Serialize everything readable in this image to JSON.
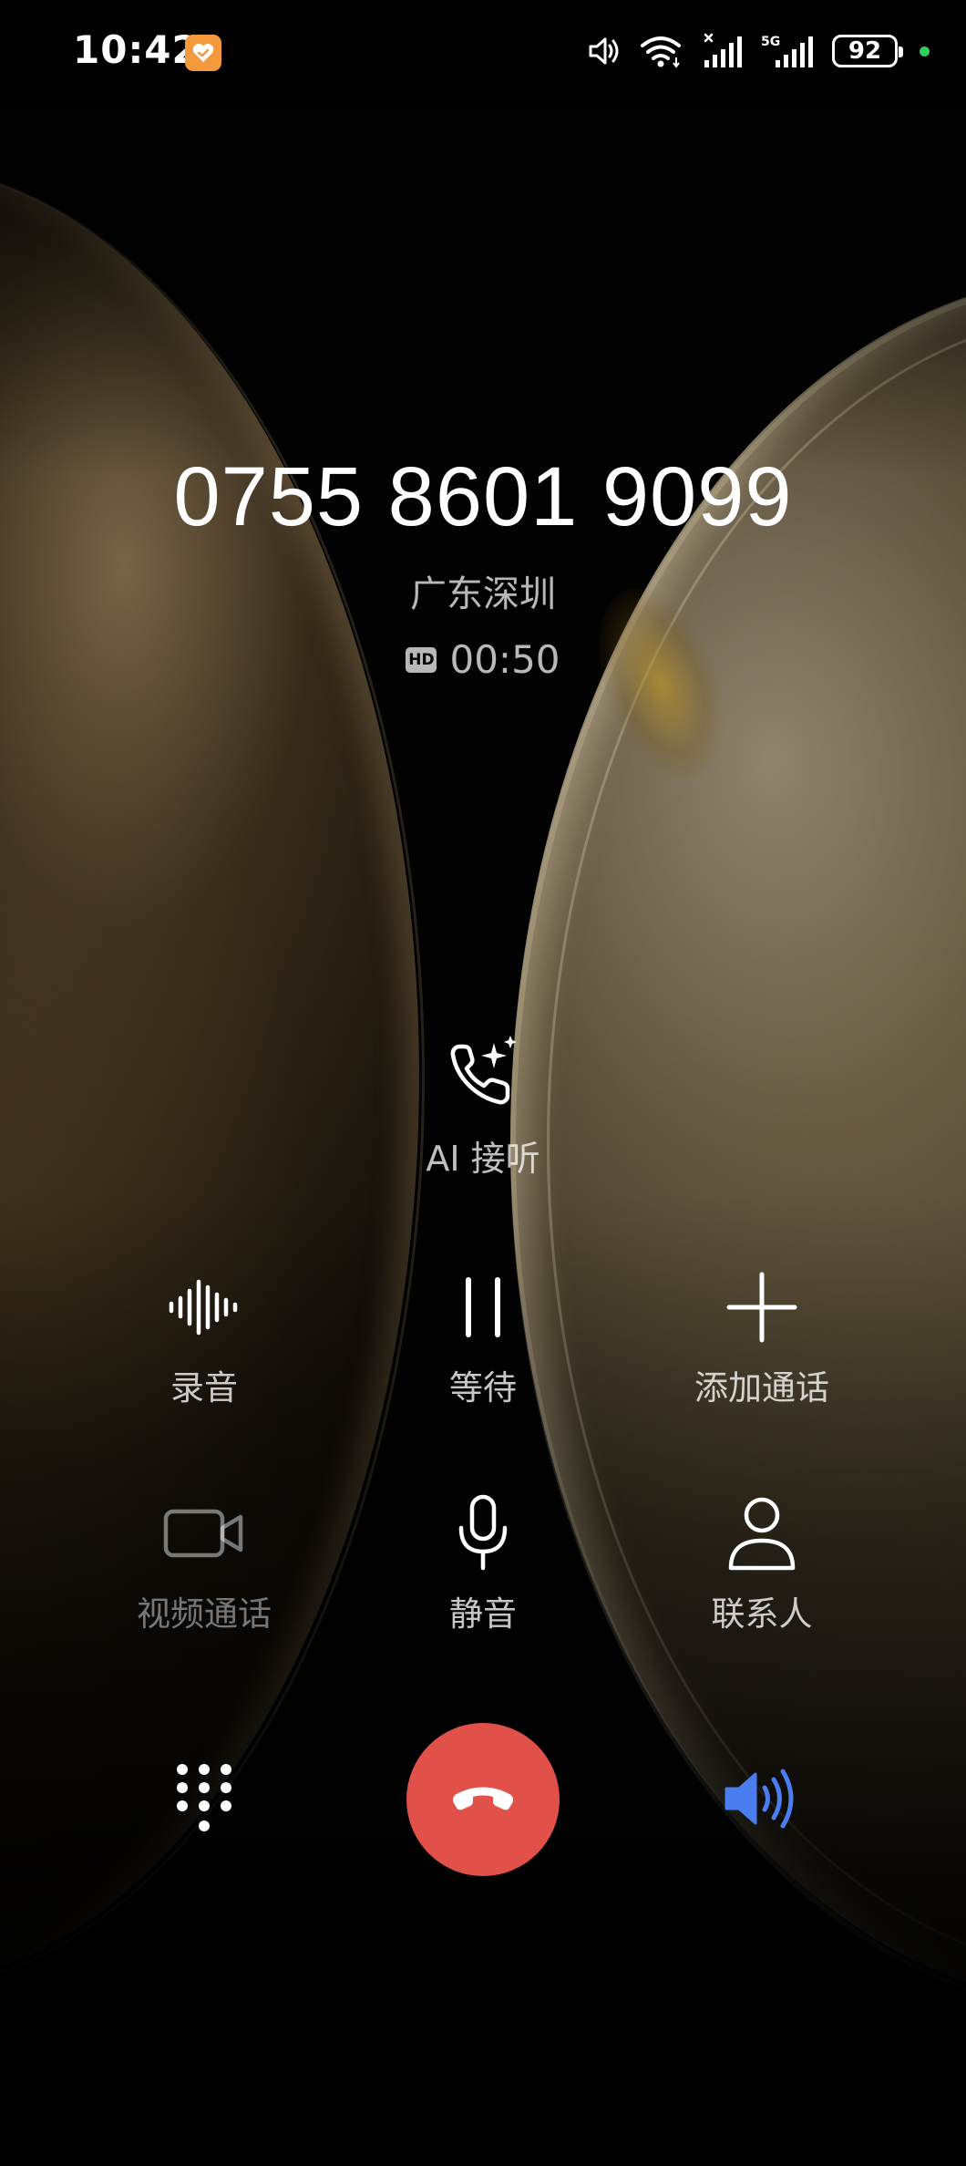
{
  "status_bar": {
    "time": "10:42",
    "battery_level": "92",
    "network_type": "5G",
    "icons": [
      "volume-icon",
      "wifi-icon",
      "signal-icon",
      "signal-5g-icon",
      "battery-icon",
      "charging-dot-icon"
    ]
  },
  "call": {
    "number": "0755 8601 9099",
    "location": "广东深圳",
    "quality_badge": "HD",
    "duration": "00:50"
  },
  "ai_answer": {
    "label": "AI 接听",
    "icon": "phone-sparkle-icon"
  },
  "controls": {
    "record": {
      "label": "录音",
      "icon": "waveform-icon"
    },
    "hold": {
      "label": "等待",
      "icon": "pause-icon"
    },
    "add_call": {
      "label": "添加通话",
      "icon": "plus-icon"
    },
    "video_call": {
      "label": "视频通话",
      "icon": "video-camera-icon",
      "enabled": false
    },
    "mute": {
      "label": "静音",
      "icon": "microphone-icon"
    },
    "contacts": {
      "label": "联系人",
      "icon": "person-icon"
    }
  },
  "bottom_bar": {
    "keypad_icon": "dialpad-icon",
    "end_call_icon": "hang-up-icon",
    "speaker_icon": "speaker-icon",
    "speaker_active": true
  },
  "colors": {
    "end_call": "#e2504a",
    "speaker_active": "#4a7df0",
    "charging_dot": "#2fcf5a",
    "app_badge": "#f59a3c"
  }
}
